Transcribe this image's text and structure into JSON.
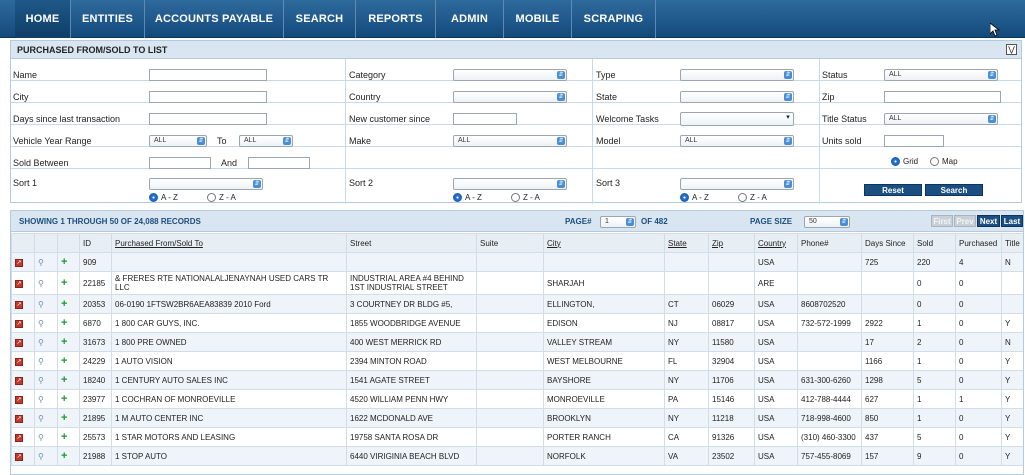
{
  "nav": {
    "items": [
      "HOME",
      "ENTITIES",
      "ACCOUNTS PAYABLE",
      "SEARCH",
      "REPORTS",
      "ADMIN",
      "MOBILE",
      "SCRAPING"
    ],
    "active": "HOME"
  },
  "panel": {
    "title": "PURCHASED FROM/SOLD TO LIST",
    "labels": {
      "name": "Name",
      "city": "City",
      "days_since": "Days since last transaction",
      "vehicle_year": "Vehicle Year Range",
      "to": "To",
      "sold_between": "Sold Between",
      "and": "And",
      "sort1": "Sort 1",
      "category": "Category",
      "country": "Country",
      "new_customer": "New customer since",
      "make": "Make",
      "sort2": "Sort 2",
      "type": "Type",
      "state": "State",
      "welcome": "Welcome Tasks",
      "model": "Model",
      "sort3": "Sort 3",
      "status": "Status",
      "zip": "Zip",
      "title_status": "Title Status",
      "units_sold": "Units sold"
    },
    "selects": {
      "status": "ALL",
      "year_from": "ALL",
      "year_to": "ALL",
      "make": "ALL",
      "model": "ALL",
      "title_status": "ALL"
    },
    "radios": {
      "az": "A - Z",
      "za": "Z - A",
      "grid": "Grid",
      "map": "Map"
    },
    "buttons": {
      "reset": "Reset",
      "search": "Search"
    }
  },
  "results": {
    "summary": "SHOWING 1 THROUGH 50 OF 24,088 RECORDS",
    "page_label": "PAGE#",
    "page_value": "1",
    "page_of": "OF 482",
    "page_size_label": "PAGE SIZE",
    "page_size": "50",
    "pager": {
      "first": "First",
      "prev": "Prev",
      "next": "Next",
      "last": "Last"
    },
    "columns": [
      "ID",
      "Purchased From/Sold To",
      "Street",
      "Suite",
      "City",
      "State",
      "Zip",
      "Country",
      "Phone#",
      "Days Since",
      "Sold",
      "Purchased",
      "Title"
    ],
    "rows": [
      {
        "id": "909",
        "name": "",
        "street": "",
        "suite": "",
        "city": "",
        "state": "",
        "zip": "",
        "country": "USA",
        "phone": "",
        "days": "725",
        "sold": "220",
        "purchased": "4",
        "title": "N"
      },
      {
        "id": "22185",
        "name": "& FRERES RTE NATIONALALJENAYNAH USED CARS TR LLC",
        "street": "INDUSTRIAL AREA #4 BEHIND 1ST INDUSTRIAL STREET",
        "suite": "",
        "city": "SHARJAH",
        "state": "",
        "zip": "",
        "country": "ARE",
        "phone": "",
        "days": "",
        "sold": "0",
        "purchased": "0",
        "title": ""
      },
      {
        "id": "20353",
        "name": "06-0190 1FTSW2BR6AEA83839 2010 Ford",
        "street": "3 COURTNEY DR BLDG #5,",
        "suite": "",
        "city": "ELLINGTON,",
        "state": "CT",
        "zip": "06029",
        "country": "USA",
        "phone": "8608702520",
        "days": "",
        "sold": "0",
        "purchased": "0",
        "title": ""
      },
      {
        "id": "6870",
        "name": "1 800 CAR GUYS, INC.",
        "street": "1855 WOODBRIDGE AVENUE",
        "suite": "",
        "city": "EDISON",
        "state": "NJ",
        "zip": "08817",
        "country": "USA",
        "phone": "732-572-1999",
        "days": "2922",
        "sold": "1",
        "purchased": "0",
        "title": "Y"
      },
      {
        "id": "31673",
        "name": "1 800 PRE OWNED",
        "street": "400 WEST MERRICK RD",
        "suite": "",
        "city": "VALLEY STREAM",
        "state": "NY",
        "zip": "11580",
        "country": "USA",
        "phone": "",
        "days": "17",
        "sold": "2",
        "purchased": "0",
        "title": "N"
      },
      {
        "id": "24229",
        "name": "1 AUTO VISION",
        "street": "2394 MINTON ROAD",
        "suite": "",
        "city": "WEST MELBOURNE",
        "state": "FL",
        "zip": "32904",
        "country": "USA",
        "phone": "",
        "days": "1166",
        "sold": "1",
        "purchased": "0",
        "title": "Y"
      },
      {
        "id": "18240",
        "name": "1 CENTURY AUTO SALES INC",
        "street": "1541 AGATE STREET",
        "suite": "",
        "city": "BAYSHORE",
        "state": "NY",
        "zip": "11706",
        "country": "USA",
        "phone": "631-300-6260",
        "days": "1298",
        "sold": "5",
        "purchased": "0",
        "title": "Y"
      },
      {
        "id": "23977",
        "name": "1 COCHRAN OF MONROEVILLE",
        "street": "4520 WILLIAM PENN HWY",
        "suite": "",
        "city": "MONROEVILLE",
        "state": "PA",
        "zip": "15146",
        "country": "USA",
        "phone": "412-788-4444",
        "days": "627",
        "sold": "1",
        "purchased": "1",
        "title": "Y"
      },
      {
        "id": "21895",
        "name": "1 M AUTO CENTER INC",
        "street": "1622 MCDONALD AVE",
        "suite": "",
        "city": "BROOKLYN",
        "state": "NY",
        "zip": "11218",
        "country": "USA",
        "phone": "718-998-4600",
        "days": "850",
        "sold": "1",
        "purchased": "0",
        "title": "Y"
      },
      {
        "id": "25573",
        "name": "1 STAR MOTORS AND LEASING",
        "street": "19758 SANTA ROSA DR",
        "suite": "",
        "city": "PORTER RANCH",
        "state": "CA",
        "zip": "91326",
        "country": "USA",
        "phone": "(310) 460-3300",
        "days": "437",
        "sold": "5",
        "purchased": "0",
        "title": "Y"
      },
      {
        "id": "21988",
        "name": "1 STOP AUTO",
        "street": "6440 VIRIGINIA BEACH BLVD",
        "suite": "",
        "city": "NORFOLK",
        "state": "VA",
        "zip": "23502",
        "country": "USA",
        "phone": "757-455-8069",
        "days": "157",
        "sold": "9",
        "purchased": "0",
        "title": "Y"
      }
    ]
  }
}
